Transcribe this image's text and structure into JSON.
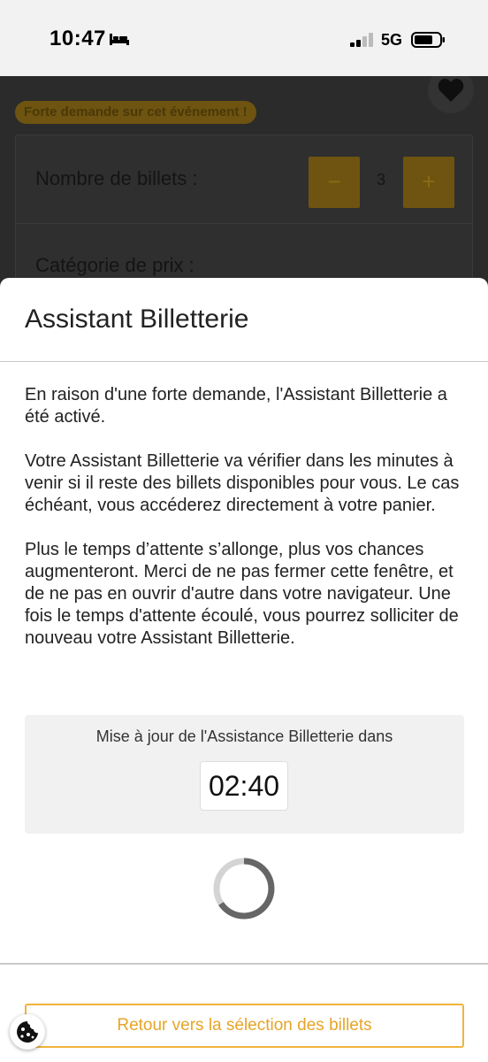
{
  "status_bar": {
    "time": "10:47",
    "network": "5G",
    "icons": [
      "bed-icon",
      "signal-icon",
      "battery-icon"
    ]
  },
  "background_page": {
    "badge": "Forte demande sur cet événement !",
    "tickets_label": "Nombre de billets :",
    "minus_label": "−",
    "quantity": "3",
    "plus_label": "+",
    "price_category_label": "Catégorie de prix :",
    "icons": [
      "heart-icon"
    ]
  },
  "modal": {
    "title": "Assistant Billetterie",
    "paragraphs": [
      "En raison d'une forte demande, l'Assistant Billetterie a été activé.",
      "Votre Assistant Billetterie va vérifier dans les minutes à venir si il reste des billets disponibles pour vous. Le cas échéant, vous accéderez directement à votre panier.",
      "Plus le temps d’attente s’allonge, plus vos chances augmenteront. Merci de ne pas fermer cette fenêtre, et de ne pas en ouvrir d'autre dans votre navigateur. Une fois le temps d'attente écoulé, vous pourrez solliciter de nouveau votre Assistant Billetterie."
    ],
    "timer_label": "Mise à jour de l'Assistance Billetterie dans",
    "timer_value": "02:40",
    "back_button": "Retour vers la sélection des billets"
  },
  "colors": {
    "accent": "#f0b43c",
    "accent_text": "#e6a528",
    "overlay": "#2b2b2b"
  },
  "icons": [
    "spinner-icon",
    "cookie-icon"
  ]
}
